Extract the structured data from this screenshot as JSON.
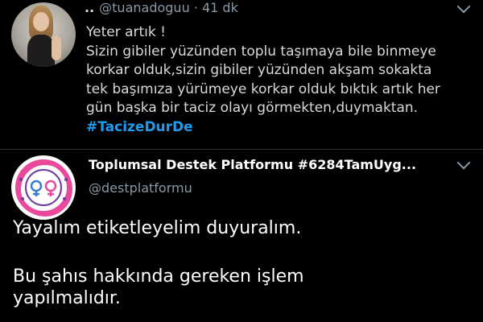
{
  "tweet1": {
    "dots": "..",
    "handle": "@tuanadoguu",
    "separator": "·",
    "time": "41 dk",
    "lines": [
      "Yeter artık !",
      "Sizin gibiler yüzünden toplu taşımaya bile binmeye",
      "korkar olduk,sizin gibiler yüzünden akşam sokakta",
      "tek başımıza yürümeye korkar olduk bıktık artık her",
      "gün başka bir taciz olayı görmekten,duymaktan."
    ],
    "hashtag": "#TacizeDurDe"
  },
  "tweet2": {
    "name": "Toplumsal Destek Platformu #6284TamUyg...",
    "handle": "@destplatformu",
    "line1": "Yayalım etiketleyelim duyuralım.",
    "line2": "Bu şahıs hakkında gereken işlem",
    "line3": "yapılmalıdır."
  },
  "colors": {
    "background": "#000000",
    "text": "#d9d9d9",
    "muted": "#8899a6",
    "hashtag": "#1d9bf0",
    "logo_pink": "#e8499b",
    "logo_purple": "#6a3d9a"
  },
  "icons": {
    "menu": "chevron-down-icon"
  }
}
